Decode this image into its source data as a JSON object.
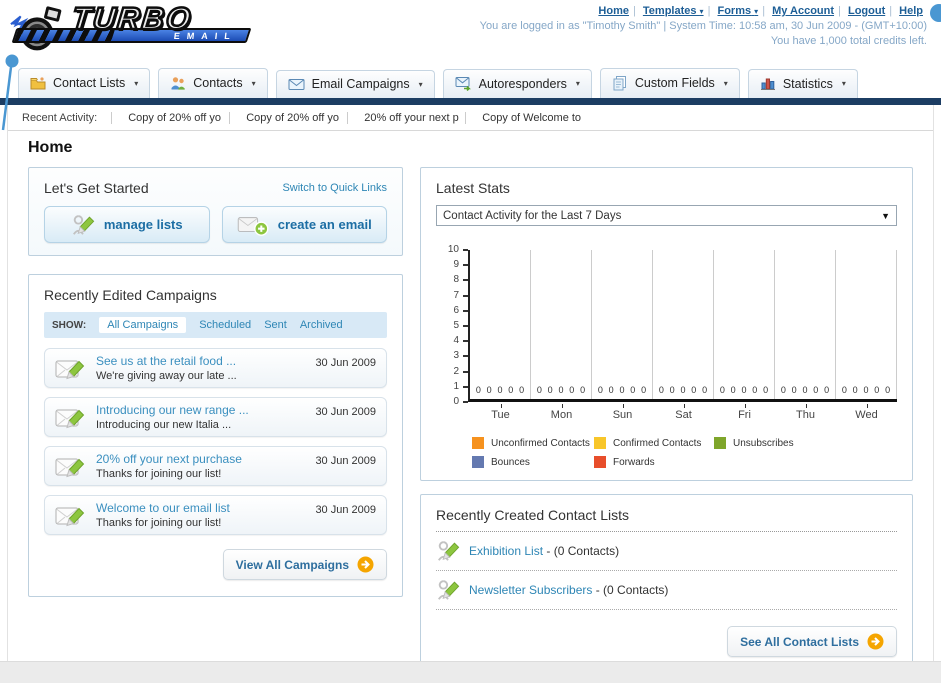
{
  "header": {
    "links": [
      {
        "label": "Home"
      },
      {
        "label": "Templates"
      },
      {
        "label": "Forms"
      },
      {
        "label": "My Account"
      },
      {
        "label": "Logout"
      },
      {
        "label": "Help"
      }
    ],
    "logo_title": "TURBO",
    "logo_subtitle": "EMAIL",
    "login_info": "You are logged in as \"Timothy Smith\" | System Time: 10:58 am, 30 Jun 2009 - (GMT+10:00)",
    "credits_info": "You have 1,000 total credits left."
  },
  "nav": {
    "tabs": [
      {
        "label": "Contact Lists",
        "icon": "contact-lists-icon"
      },
      {
        "label": "Contacts",
        "icon": "contacts-icon"
      },
      {
        "label": "Email Campaigns",
        "icon": "email-campaigns-icon"
      },
      {
        "label": "Autoresponders",
        "icon": "autoresponders-icon"
      },
      {
        "label": "Custom Fields",
        "icon": "custom-fields-icon"
      },
      {
        "label": "Statistics",
        "icon": "statistics-icon"
      }
    ]
  },
  "activity": {
    "label": "Recent Activity:",
    "items": [
      "Copy of 20% off yo",
      "Copy of 20% off yo",
      "20% off your next p",
      "Copy of Welcome to"
    ]
  },
  "page": {
    "title": "Home"
  },
  "get_started": {
    "title": "Let's Get Started",
    "switch_link": "Switch to Quick Links",
    "manage_lists_label": "manage lists",
    "create_email_label": "create an email"
  },
  "campaigns": {
    "title": "Recently Edited Campaigns",
    "show_label": "SHOW:",
    "filters": [
      "All Campaigns",
      "Scheduled",
      "Sent",
      "Archived"
    ],
    "active_filter": "All Campaigns",
    "items": [
      {
        "title": "See us at the retail food ...",
        "subtitle": "We're giving away our late ...",
        "date": "30 Jun 2009"
      },
      {
        "title": "Introducing our new range ...",
        "subtitle": "Introducing our new Italia ...",
        "date": "30 Jun 2009"
      },
      {
        "title": "20% off your next purchase",
        "subtitle": "Thanks for joining our list!",
        "date": "30 Jun 2009"
      },
      {
        "title": "Welcome to our email list",
        "subtitle": "Thanks for joining our list!",
        "date": "30 Jun 2009"
      }
    ],
    "view_all_label": "View All Campaigns"
  },
  "stats": {
    "title": "Latest Stats",
    "dropdown_value": "Contact Activity for the Last 7 Days"
  },
  "chart_data": {
    "type": "bar",
    "title": "Contact Activity for the Last 7 Days",
    "categories": [
      "Tue",
      "Mon",
      "Sun",
      "Sat",
      "Fri",
      "Thu",
      "Wed"
    ],
    "series": [
      {
        "name": "Unconfirmed Contacts",
        "color": "#F6921E",
        "values": [
          0,
          0,
          0,
          0,
          0,
          0,
          0
        ]
      },
      {
        "name": "Confirmed Contacts",
        "color": "#F8C62A",
        "values": [
          0,
          0,
          0,
          0,
          0,
          0,
          0
        ]
      },
      {
        "name": "Unsubscribes",
        "color": "#7FA62B",
        "values": [
          0,
          0,
          0,
          0,
          0,
          0,
          0
        ]
      },
      {
        "name": "Bounces",
        "color": "#6479B0",
        "values": [
          0,
          0,
          0,
          0,
          0,
          0,
          0
        ]
      },
      {
        "name": "Forwards",
        "color": "#E84E2B",
        "values": [
          0,
          0,
          0,
          0,
          0,
          0,
          0
        ]
      }
    ],
    "xlabel": "",
    "ylabel": "",
    "ylim": [
      0,
      10
    ],
    "yticks": [
      0,
      1,
      2,
      3,
      4,
      5,
      6,
      7,
      8,
      9,
      10
    ],
    "grid": true,
    "legend_position": "bottom"
  },
  "contact_lists": {
    "title": "Recently Created Contact Lists",
    "items": [
      {
        "name": "Exhibition List",
        "suffix": "- (0 Contacts)"
      },
      {
        "name": "Newsletter Subscribers",
        "suffix": "- (0 Contacts)"
      }
    ],
    "see_all_label": "See All Contact Lists"
  }
}
